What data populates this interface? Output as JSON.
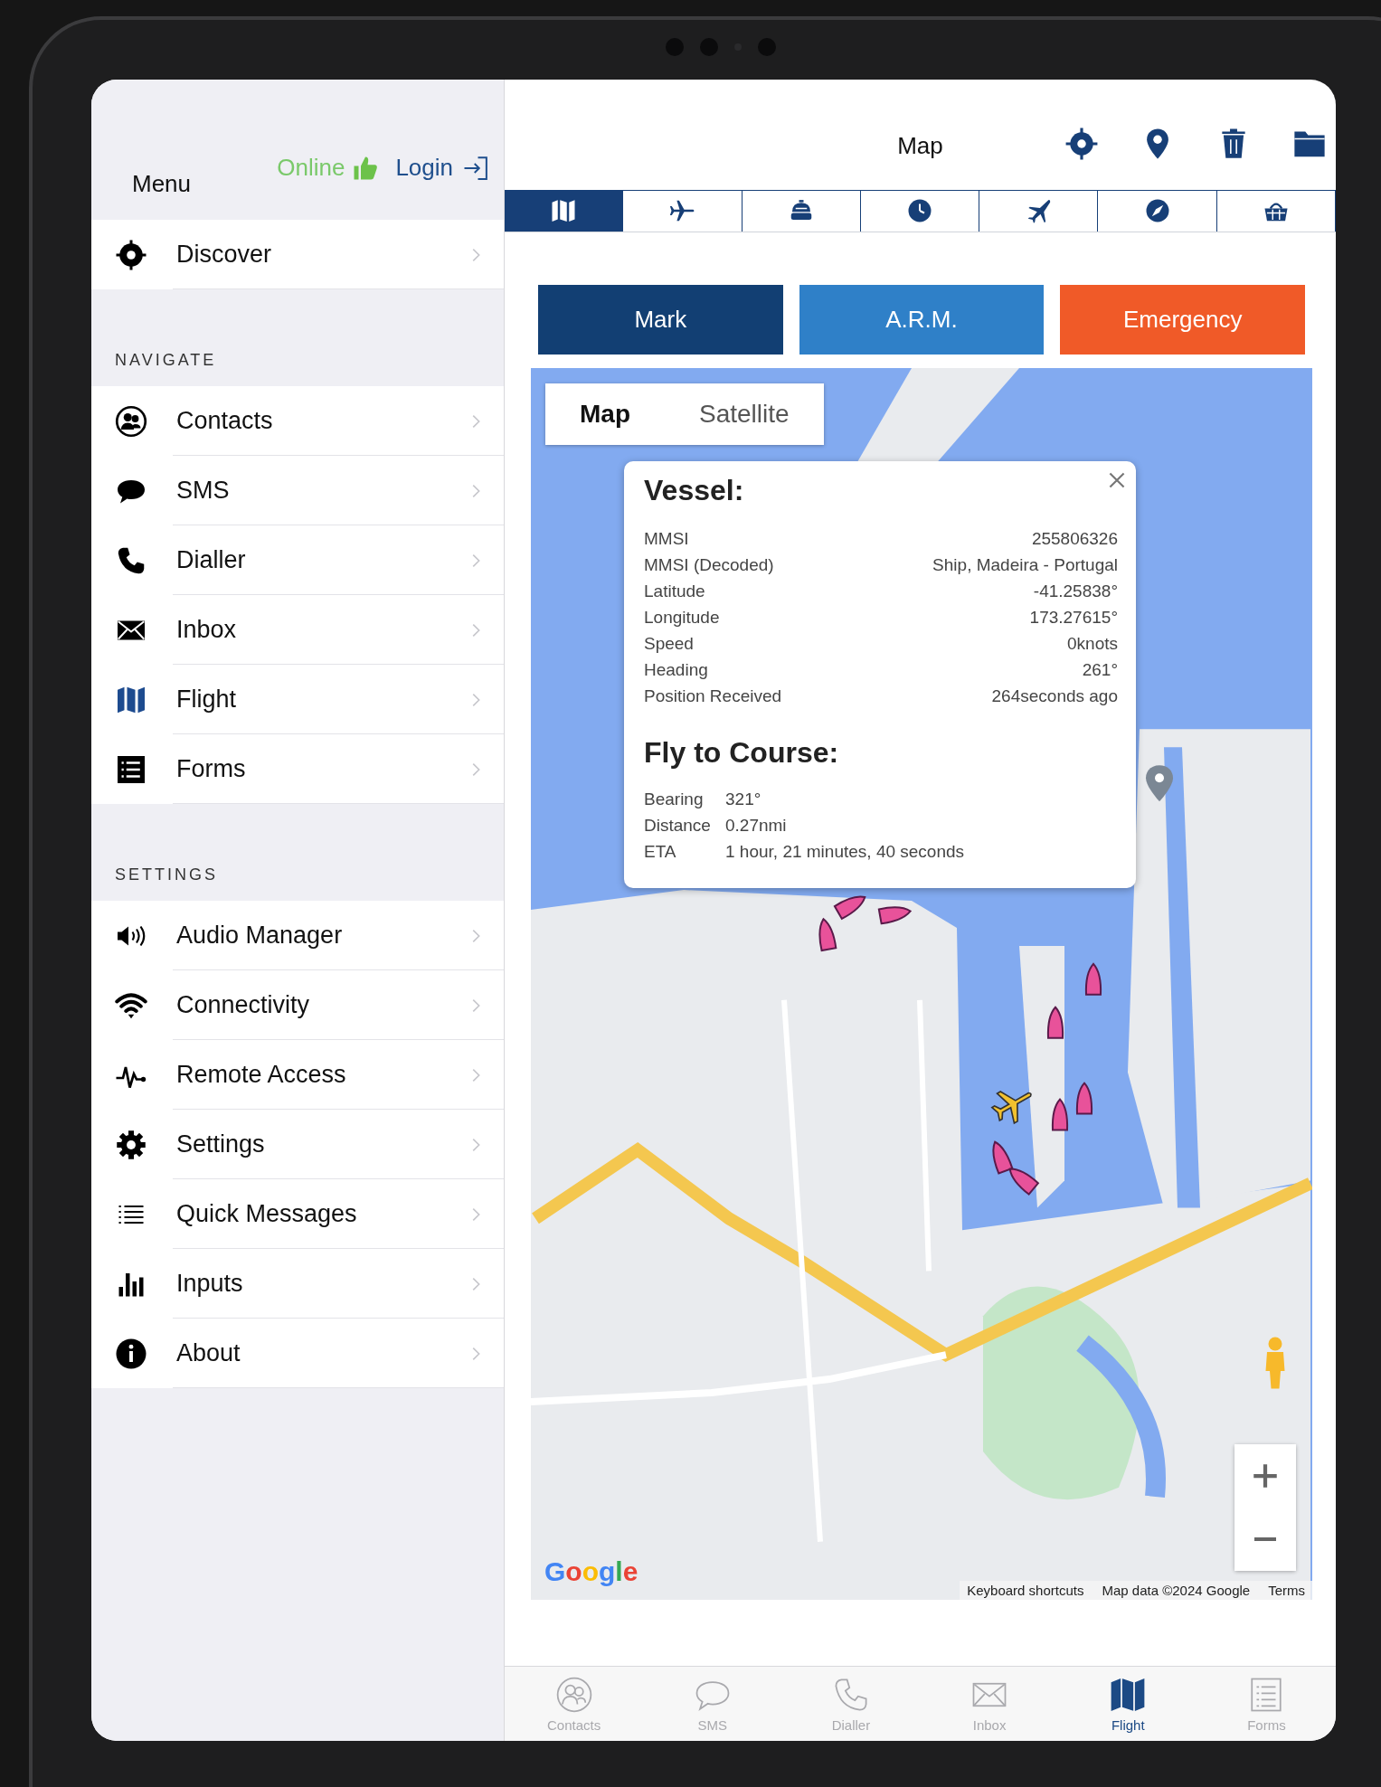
{
  "sidebar": {
    "title": "Menu",
    "status": "Online",
    "login": "Login",
    "top_items": [
      {
        "label": "Discover"
      }
    ],
    "sections": [
      {
        "heading": "NAVIGATE",
        "items": [
          {
            "label": "Contacts"
          },
          {
            "label": "SMS"
          },
          {
            "label": "Dialler"
          },
          {
            "label": "Inbox"
          },
          {
            "label": "Flight"
          },
          {
            "label": "Forms"
          }
        ]
      },
      {
        "heading": "SETTINGS",
        "items": [
          {
            "label": "Audio Manager"
          },
          {
            "label": "Connectivity"
          },
          {
            "label": "Remote Access"
          },
          {
            "label": "Settings"
          },
          {
            "label": "Quick Messages"
          },
          {
            "label": "Inputs"
          },
          {
            "label": "About"
          }
        ]
      }
    ]
  },
  "header": {
    "title": "Map"
  },
  "mode_tabs": [
    {
      "selected": true
    },
    {
      "selected": false
    },
    {
      "selected": false
    },
    {
      "selected": false
    },
    {
      "selected": false
    },
    {
      "selected": false
    },
    {
      "selected": false
    }
  ],
  "actions": [
    {
      "label": "Mark",
      "color": "#123f73"
    },
    {
      "label": "A.R.M.",
      "color": "#2f80c8"
    },
    {
      "label": "Emergency",
      "color": "#f05a28"
    }
  ],
  "map": {
    "type_toggle": [
      {
        "label": "Map",
        "selected": true
      },
      {
        "label": "Satellite",
        "selected": false
      }
    ],
    "info_window": {
      "vessel_title": "Vessel:",
      "vessel_rows": [
        {
          "label": "MMSI",
          "value": "255806326"
        },
        {
          "label": "MMSI (Decoded)",
          "value": "Ship, Madeira - Portugal"
        },
        {
          "label": "Latitude",
          "value": "-41.25838°"
        },
        {
          "label": "Longitude",
          "value": "173.27615°"
        },
        {
          "label": "Speed",
          "value": "0knots"
        },
        {
          "label": "Heading",
          "value": "261°"
        },
        {
          "label": "Position Received",
          "value": "264seconds ago"
        }
      ],
      "course_title": "Fly to Course:",
      "course_rows": [
        {
          "label": "Bearing",
          "value": "321°"
        },
        {
          "label": "Distance",
          "value": "0.27nmi"
        },
        {
          "label": "ETA",
          "value": "1 hour, 21 minutes, 40 seconds"
        }
      ]
    },
    "logo": "Google",
    "footer": [
      "Keyboard shortcuts",
      "Map data ©2024 Google",
      "Terms"
    ]
  },
  "tab_bar": [
    {
      "label": "Contacts",
      "selected": false
    },
    {
      "label": "SMS",
      "selected": false
    },
    {
      "label": "Dialler",
      "selected": false
    },
    {
      "label": "Inbox",
      "selected": false
    },
    {
      "label": "Flight",
      "selected": true
    },
    {
      "label": "Forms",
      "selected": false
    }
  ]
}
